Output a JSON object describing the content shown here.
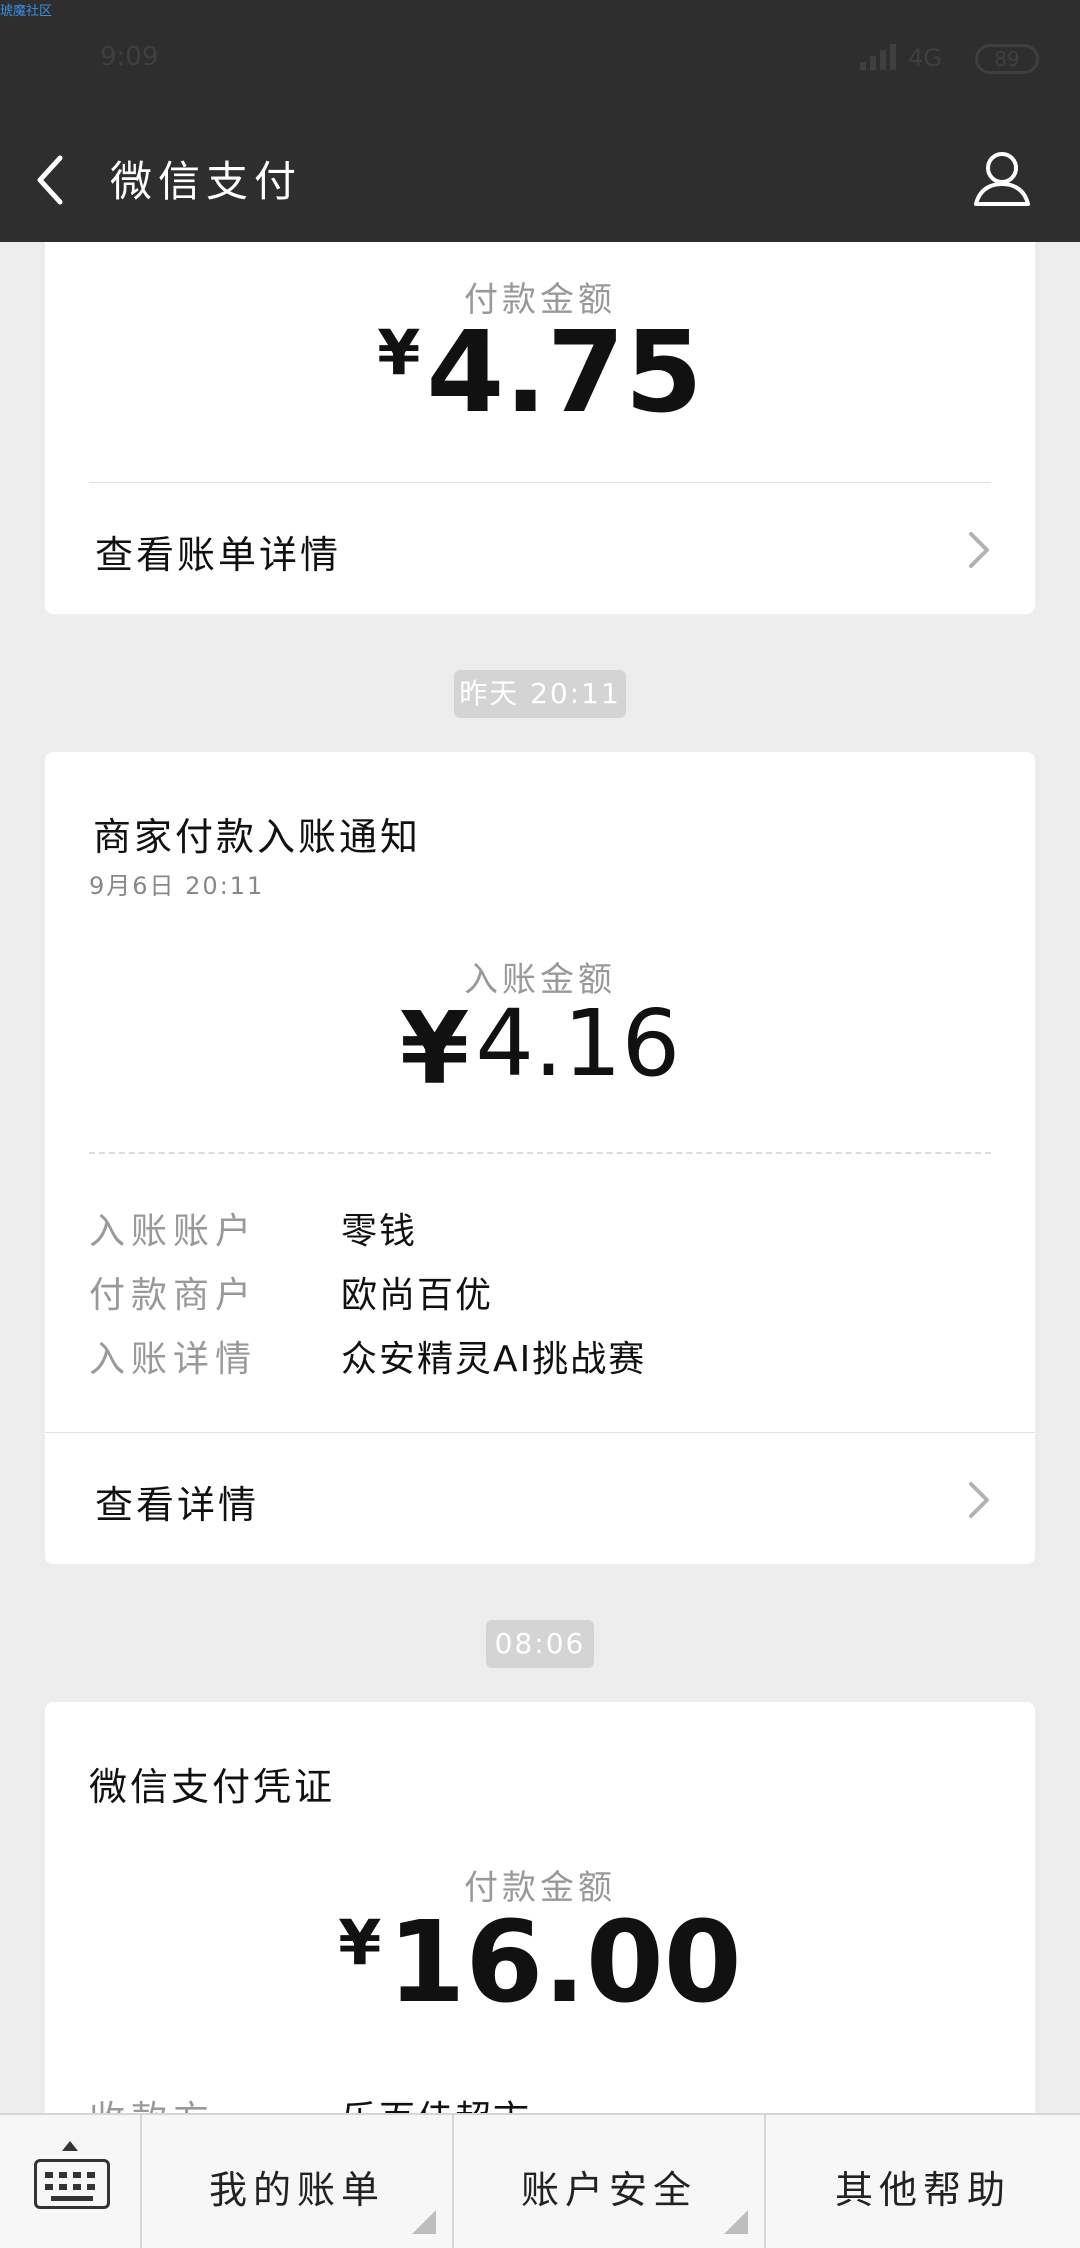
{
  "watermark": "琥魔社区",
  "status_bar": {
    "time": "9:09",
    "network": "4G",
    "battery": "89"
  },
  "navbar": {
    "title": "微信支付",
    "back_icon": "back-chevron-icon",
    "profile_icon": "user-profile-icon"
  },
  "messages": [
    {
      "amount_label": "付款金额",
      "currency": "¥",
      "amount": "4.75",
      "link_label": "查看账单详情"
    },
    {
      "time_pill": "昨天 20:11",
      "title": "商家付款入账通知",
      "date": "9月6日   20:11",
      "amount_label": "入账金额",
      "currency": "¥",
      "amount": "4.16",
      "rows": [
        {
          "label": "入账账户",
          "value": "零钱"
        },
        {
          "label": "付款商户",
          "value": "欧尚百优"
        },
        {
          "label": "入账详情",
          "value": "众安精灵AI挑战赛"
        }
      ],
      "link_label": "查看详情"
    },
    {
      "time_pill": "08:06",
      "title": "微信支付凭证",
      "amount_label": "付款金额",
      "currency": "¥",
      "amount": "16.00",
      "partial_row": {
        "label": "收款方",
        "value": "乐百佳超市"
      }
    }
  ],
  "bottom_menu": {
    "keyboard_icon": "keyboard-icon",
    "items": [
      "我的账单",
      "账户安全",
      "其他帮助"
    ]
  },
  "colors": {
    "header_bg": "#2e2e2e",
    "page_bg": "#ededed",
    "card_bg": "#ffffff",
    "muted_text": "#999999"
  }
}
